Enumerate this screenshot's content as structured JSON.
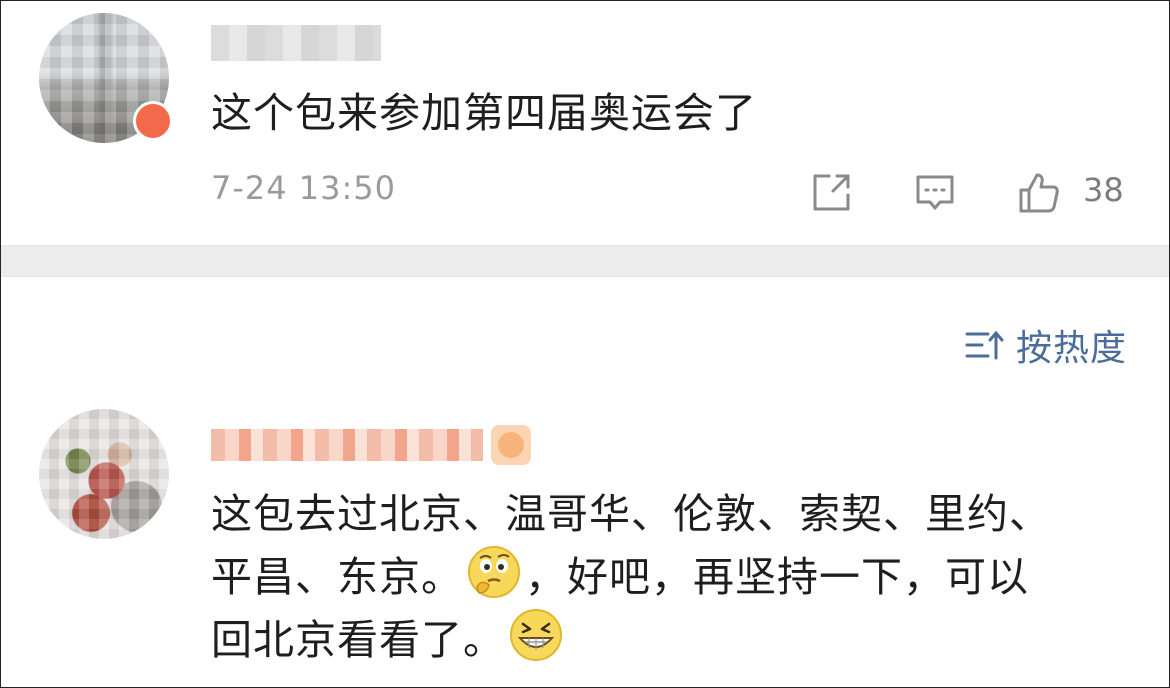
{
  "comment_1": {
    "text": "这个包来参加第四届奥运会了",
    "timestamp": "7-24 13:50",
    "actions": {
      "share_icon": "share-icon",
      "comment_icon": "comment-icon",
      "like_icon": "thumbs-up-icon",
      "like_count": "38"
    }
  },
  "sort": {
    "icon": "sort-icon",
    "label": "按热度"
  },
  "comment_2": {
    "line_1": "这包去过北京、温哥华、伦敦、索契、里约、",
    "line_2_part_1": "平昌、东京。",
    "emoji_1": "thinking-face-icon",
    "line_2_part_2": "，好吧，再坚持一下，可以",
    "line_3": "回北京看看了。",
    "emoji_2": "grinning-face-icon"
  },
  "colors": {
    "accent_blue": "#4a6d9c",
    "timestamp_gray": "#9a9a9a",
    "separator_gray": "#ececec"
  }
}
